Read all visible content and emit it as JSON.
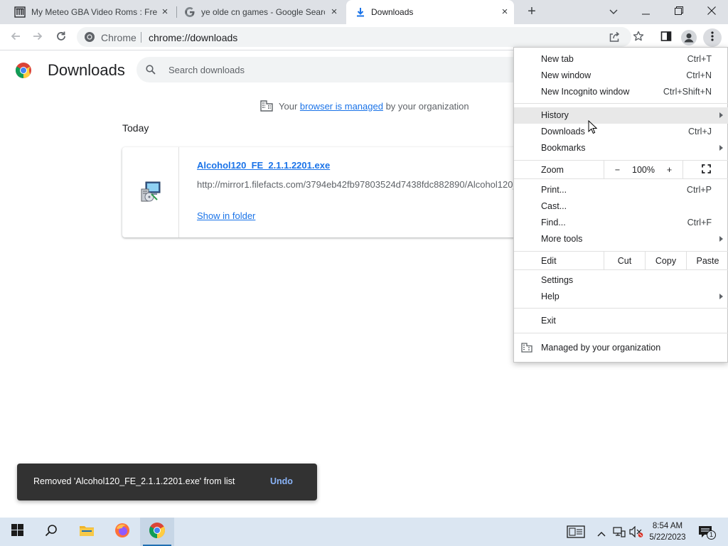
{
  "tabs": [
    {
      "title": "My Meteo GBA Video Roms : Fre",
      "close": "×"
    },
    {
      "title": "ye olde cn games - Google Searc",
      "close": "×"
    },
    {
      "title": "Downloads",
      "close": "×"
    }
  ],
  "tabstrip": {
    "new_tab": "+"
  },
  "toolbar": {
    "omni_chrome": "Chrome",
    "url": "chrome://downloads"
  },
  "downloads_page": {
    "title": "Downloads",
    "search_placeholder": "Search downloads",
    "managed_prefix": "Your ",
    "managed_link": "browser is managed",
    "managed_suffix": " by your organization",
    "section_date": "Today",
    "item": {
      "file_name": "Alcohol120_FE_2.1.1.2201.exe",
      "url": "http://mirror1.filefacts.com/3794eb42fb97803524d7438fdc882890/Alcohol120_FE_2.1.1.2201.exe",
      "show_in_folder": "Show in folder"
    }
  },
  "toast": {
    "message": "Removed 'Alcohol120_FE_2.1.1.2201.exe' from list",
    "undo": "Undo"
  },
  "menu": {
    "new_tab": {
      "label": "New tab",
      "shortcut": "Ctrl+T"
    },
    "new_window": {
      "label": "New window",
      "shortcut": "Ctrl+N"
    },
    "new_incognito": {
      "label": "New Incognito window",
      "shortcut": "Ctrl+Shift+N"
    },
    "history": {
      "label": "History"
    },
    "downloads": {
      "label": "Downloads",
      "shortcut": "Ctrl+J"
    },
    "bookmarks": {
      "label": "Bookmarks"
    },
    "zoom": {
      "label": "Zoom",
      "minus": "−",
      "value": "100%",
      "plus": "+"
    },
    "print": {
      "label": "Print...",
      "shortcut": "Ctrl+P"
    },
    "cast": {
      "label": "Cast..."
    },
    "find": {
      "label": "Find...",
      "shortcut": "Ctrl+F"
    },
    "more_tools": {
      "label": "More tools"
    },
    "edit": {
      "label": "Edit",
      "cut": "Cut",
      "copy": "Copy",
      "paste": "Paste"
    },
    "settings": {
      "label": "Settings"
    },
    "help": {
      "label": "Help"
    },
    "exit": {
      "label": "Exit"
    },
    "managed": {
      "label": "Managed by your organization"
    }
  },
  "taskbar": {
    "time": "8:54 AM",
    "date": "5/22/2023",
    "notification_count": "1"
  },
  "colors": {
    "accent": "#1a73e8",
    "toast_bg": "#323232",
    "toast_action": "#8ab4f8",
    "tabstrip_bg": "#dee1e6",
    "taskbar_bg": "#dbe6f2"
  }
}
